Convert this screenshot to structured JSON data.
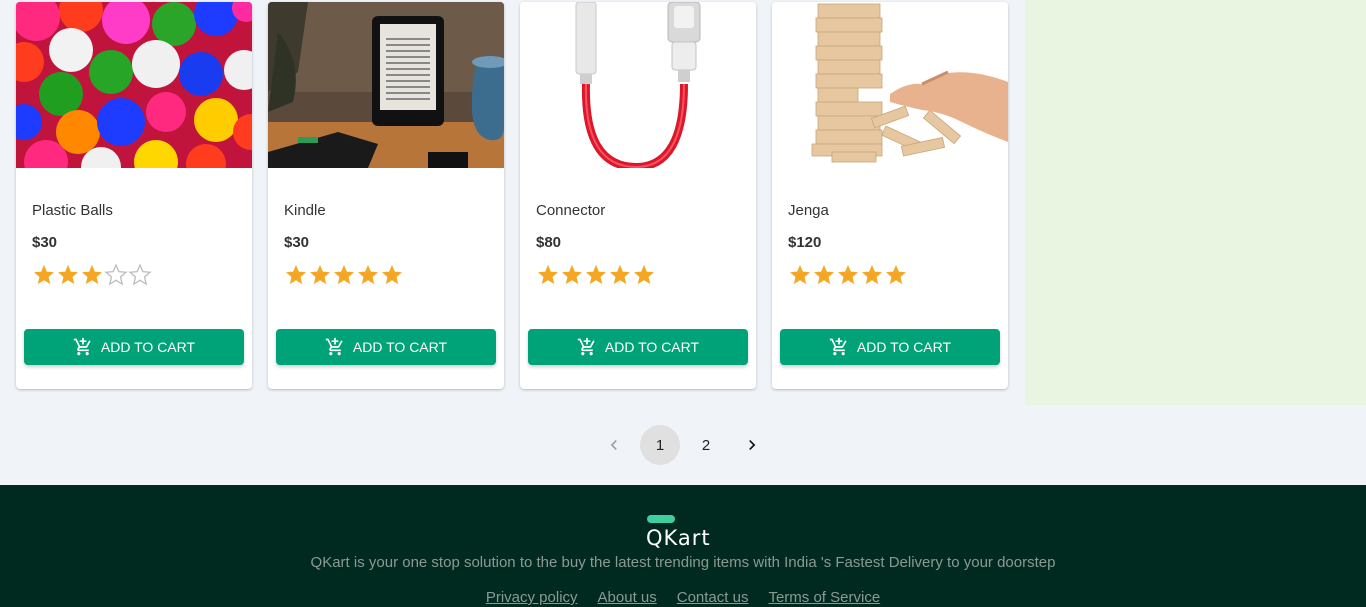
{
  "colors": {
    "accent": "#00a278",
    "star": "#f5a623",
    "footer_bg": "#002a1f",
    "cart_panel_bg": "#e9f5e1",
    "page_bg": "#f0f4f8"
  },
  "products": [
    {
      "name": "Plastic Balls",
      "price": "$30",
      "rating": 3,
      "max_rating": 5,
      "image": "colorful-balls-image",
      "button_label": "ADD TO CART"
    },
    {
      "name": "Kindle",
      "price": "$30",
      "rating": 5,
      "max_rating": 5,
      "image": "kindle-image",
      "button_label": "ADD TO CART"
    },
    {
      "name": "Connector",
      "price": "$80",
      "rating": 5,
      "max_rating": 5,
      "image": "usb-connector-image",
      "button_label": "ADD TO CART"
    },
    {
      "name": "Jenga",
      "price": "$120",
      "rating": 5,
      "max_rating": 5,
      "image": "jenga-image",
      "button_label": "ADD TO CART"
    }
  ],
  "pagination": {
    "pages": [
      "1",
      "2"
    ],
    "current": "1",
    "prev_icon": "chevron-left-icon",
    "next_icon": "chevron-right-icon"
  },
  "footer": {
    "logo": "QKart",
    "description": "QKart is your one stop solution to the buy the latest trending items with India 's Fastest Delivery to your doorstep",
    "links": [
      "Privacy policy",
      "About us",
      "Contact us",
      "Terms of Service"
    ]
  }
}
